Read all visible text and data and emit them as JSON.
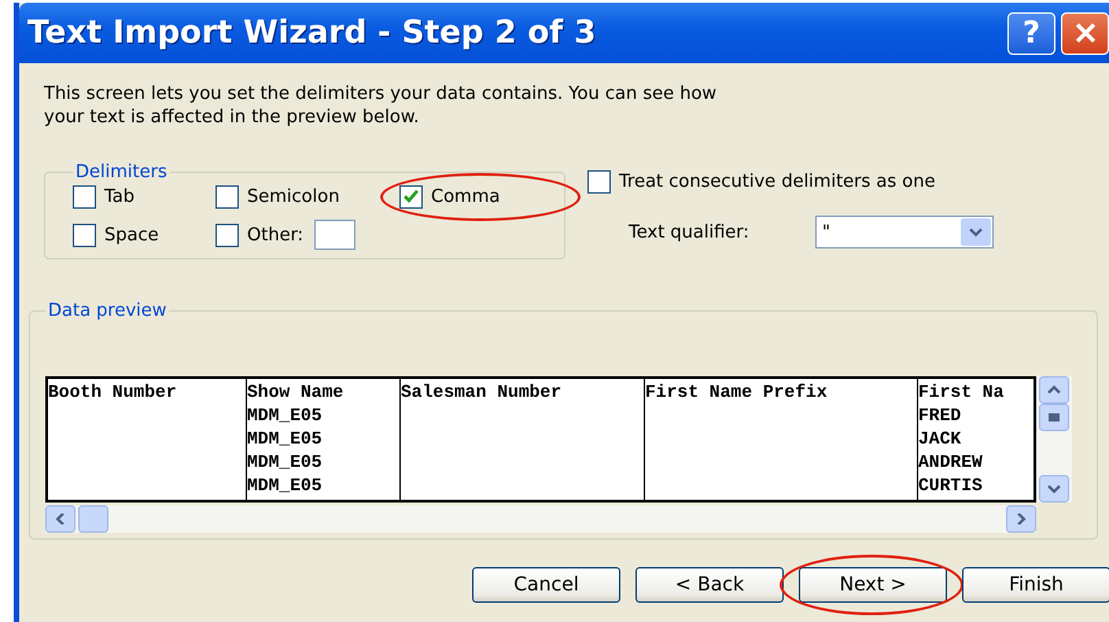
{
  "window": {
    "title": "Text Import Wizard - Step 2 of 3",
    "title_buttons": [
      {
        "kind": "help",
        "label": "?"
      },
      {
        "kind": "close"
      }
    ]
  },
  "intro": "This screen lets you set the delimiters your data contains.  You can see how your text is affected in the preview below.",
  "delimiters": {
    "title": "Delimiters",
    "options": [
      {
        "label": "Tab",
        "checked": false,
        "circled": false
      },
      {
        "label": "Semicolon",
        "checked": false,
        "circled": false
      },
      {
        "label": "Comma",
        "checked": true,
        "circled": true
      },
      {
        "label": "Space",
        "checked": false,
        "circled": false
      },
      {
        "label": "Other:",
        "checked": false,
        "circled": false,
        "kind": "other"
      }
    ]
  },
  "consecutive": {
    "label": "Treat consecutive delimiters as one",
    "checked": false
  },
  "text_qualifier": {
    "label": "Text qualifier:",
    "value": "\""
  },
  "preview": {
    "title": "Data preview",
    "columns": [
      {
        "header": "Booth Number"
      },
      {
        "header": "Show Name",
        "cells": [
          "MDM_E05",
          "MDM_E05",
          "MDM_E05",
          "MDM_E05"
        ]
      },
      {
        "header": "Salesman Number"
      },
      {
        "header": "First Name Prefix"
      },
      {
        "header": "First Na",
        "cells": [
          "FRED",
          "JACK",
          "ANDREW",
          "CURTIS"
        ]
      }
    ]
  },
  "buttons": [
    {
      "label": "Cancel",
      "circled": false
    },
    {
      "label": "< Back",
      "circled": false
    },
    {
      "label": "Next >",
      "circled": true
    },
    {
      "label": "Finish",
      "circled": false
    }
  ]
}
